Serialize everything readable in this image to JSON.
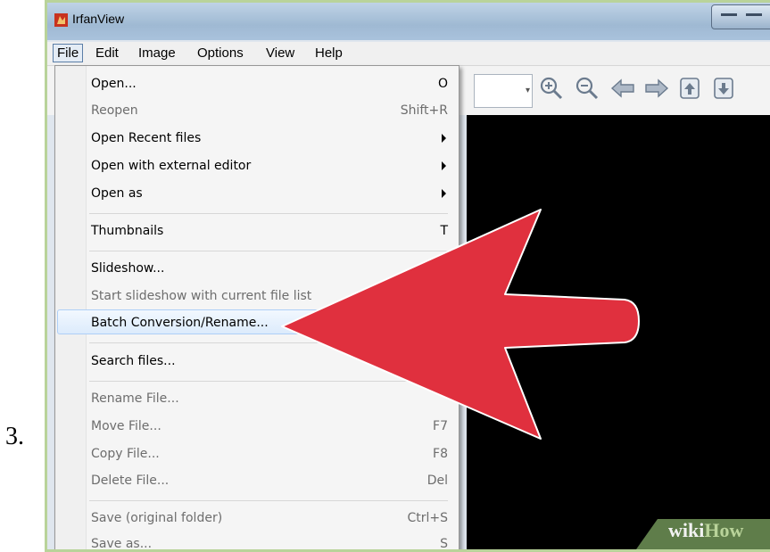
{
  "step": "3.",
  "app": {
    "title": "IrfanView"
  },
  "menubar": [
    "File",
    "Edit",
    "Image",
    "Options",
    "View",
    "Help"
  ],
  "toolbar": {
    "icons": [
      "zoom-in-icon",
      "zoom-out-icon",
      "previous-arrow-icon",
      "next-arrow-icon",
      "first-page-icon",
      "last-page-icon"
    ]
  },
  "file_menu": {
    "items": [
      {
        "label": "Open...",
        "shortcut": "O",
        "enabled": true
      },
      {
        "label": "Reopen",
        "shortcut": "Shift+R",
        "enabled": false
      },
      {
        "label": "Open Recent files",
        "submenu": true,
        "enabled": true
      },
      {
        "label": "Open with external editor",
        "submenu": true,
        "enabled": true
      },
      {
        "label": "Open as",
        "submenu": true,
        "enabled": true
      },
      {
        "label": "Thumbnails",
        "shortcut": "T",
        "enabled": true
      },
      {
        "label": "Slideshow...",
        "enabled": true
      },
      {
        "label": "Start slideshow with current file list",
        "enabled": false
      },
      {
        "label": "Batch Conversion/Rename...",
        "enabled": true,
        "highlighted": true
      },
      {
        "label": "Search files...",
        "enabled": true
      },
      {
        "label": "Rename File...",
        "enabled": false
      },
      {
        "label": "Move File...",
        "shortcut": "F7",
        "enabled": false
      },
      {
        "label": "Copy File...",
        "shortcut": "F8",
        "enabled": false
      },
      {
        "label": "Delete File...",
        "shortcut": "Del",
        "enabled": false
      },
      {
        "label": "Save (original folder)",
        "shortcut": "Ctrl+S",
        "enabled": false
      },
      {
        "label": "Save as...",
        "shortcut": "S",
        "enabled": false
      }
    ]
  },
  "watermark": {
    "part1": "wiki",
    "part2": "How"
  },
  "colors": {
    "arrow": "#e0303e",
    "viewer_bg": "#000000",
    "highlight": "#dcebfc"
  }
}
